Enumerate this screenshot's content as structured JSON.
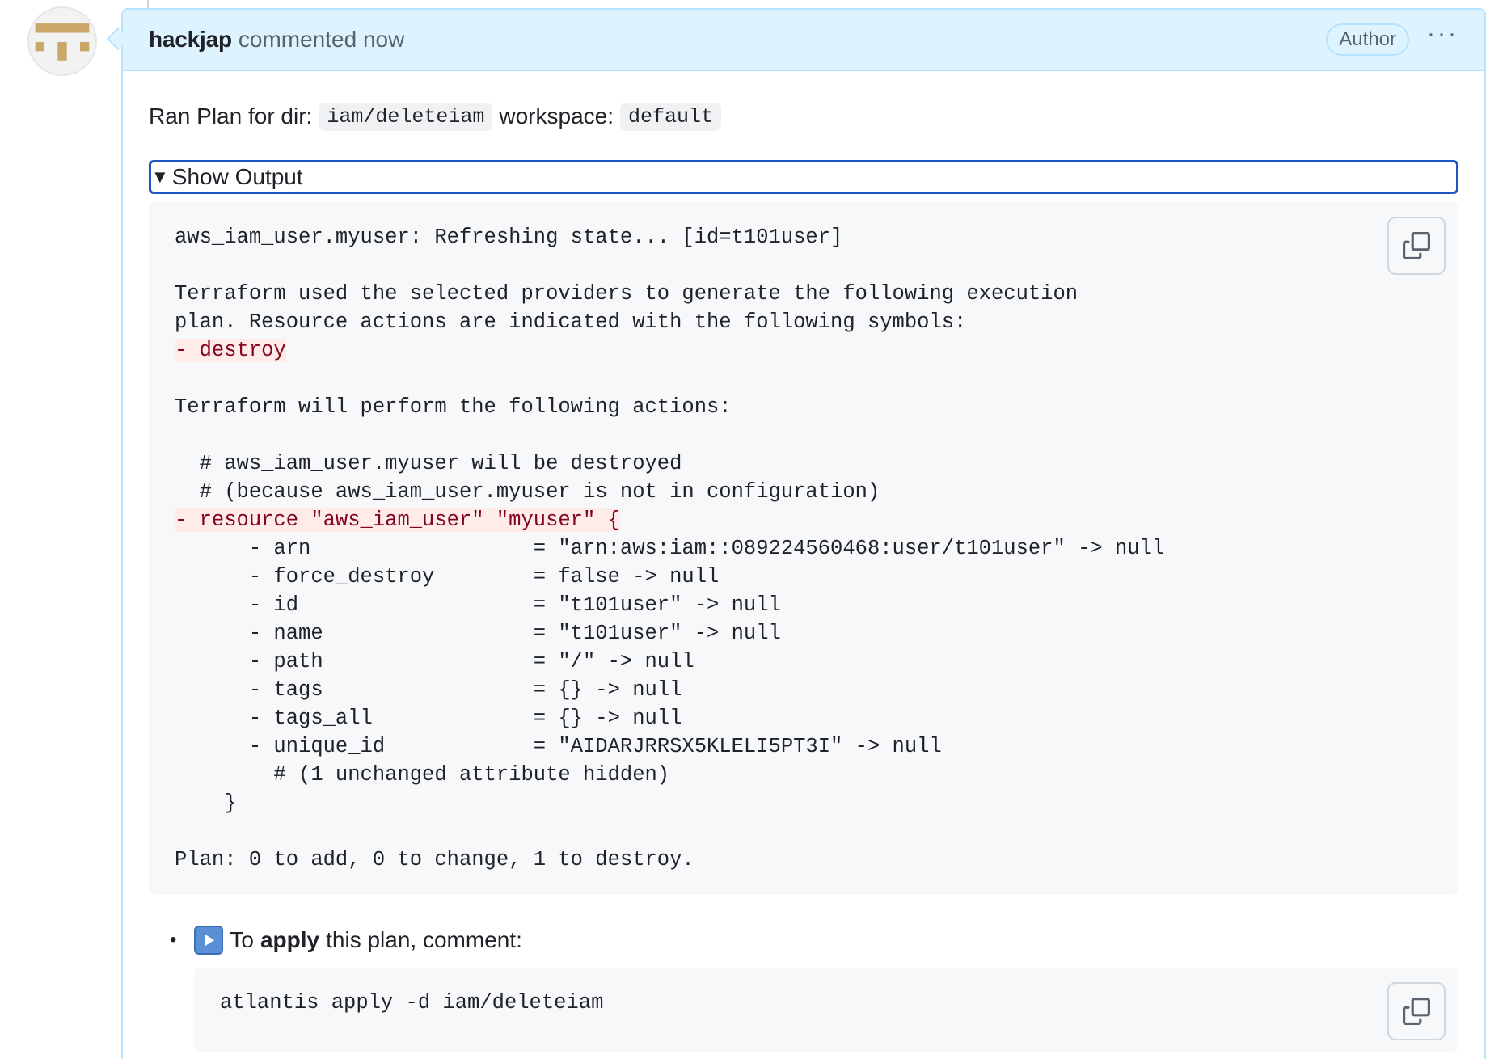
{
  "header": {
    "author": "hackjap",
    "action": "commented now",
    "badge": "Author",
    "menu": "···"
  },
  "intro": {
    "prefix": "Ran Plan for dir:",
    "dir": "iam/deleteiam",
    "workspace_label": "workspace:",
    "workspace": "default"
  },
  "details": {
    "summary": "Show Output",
    "arrow": "▼"
  },
  "output_lines": [
    {
      "text": "aws_iam_user.myuser: Refreshing state... [id=t101user]",
      "deleted": false
    },
    {
      "text": "",
      "deleted": false
    },
    {
      "text": "Terraform used the selected providers to generate the following execution",
      "deleted": false
    },
    {
      "text": "plan. Resource actions are indicated with the following symbols:",
      "deleted": false
    },
    {
      "text": "- destroy",
      "deleted": true
    },
    {
      "text": "",
      "deleted": false
    },
    {
      "text": "Terraform will perform the following actions:",
      "deleted": false
    },
    {
      "text": "",
      "deleted": false
    },
    {
      "text": "  # aws_iam_user.myuser will be destroyed",
      "deleted": false
    },
    {
      "text": "  # (because aws_iam_user.myuser is not in configuration)",
      "deleted": false
    },
    {
      "text": "- resource \"aws_iam_user\" \"myuser\" {",
      "deleted": true
    },
    {
      "text": "      - arn                  = \"arn:aws:iam::089224560468:user/t101user\" -> null",
      "deleted": false
    },
    {
      "text": "      - force_destroy        = false -> null",
      "deleted": false
    },
    {
      "text": "      - id                   = \"t101user\" -> null",
      "deleted": false
    },
    {
      "text": "      - name                 = \"t101user\" -> null",
      "deleted": false
    },
    {
      "text": "      - path                 = \"/\" -> null",
      "deleted": false
    },
    {
      "text": "      - tags                 = {} -> null",
      "deleted": false
    },
    {
      "text": "      - tags_all             = {} -> null",
      "deleted": false
    },
    {
      "text": "      - unique_id            = \"AIDARJRRSX5KLELI5PT3I\" -> null",
      "deleted": false
    },
    {
      "text": "        # (1 unchanged attribute hidden)",
      "deleted": false
    },
    {
      "text": "    }",
      "deleted": false
    },
    {
      "text": "",
      "deleted": false
    },
    {
      "text": "Plan: 0 to add, 0 to change, 1 to destroy.",
      "deleted": false
    }
  ],
  "apply": {
    "bullet": "•",
    "prefix": "To",
    "bold": "apply",
    "suffix": "this plan, comment:",
    "command": "atlantis apply -d iam/deleteiam"
  },
  "colors": {
    "header_bg": "#ddf4ff",
    "header_border": "#b6e3ff",
    "code_bg": "#f6f8fa",
    "deleted_bg": "#ffebe9",
    "deleted_fg": "#82071e",
    "focus_ring": "#1f56c6",
    "avatar_tan": "#c9a86a"
  }
}
